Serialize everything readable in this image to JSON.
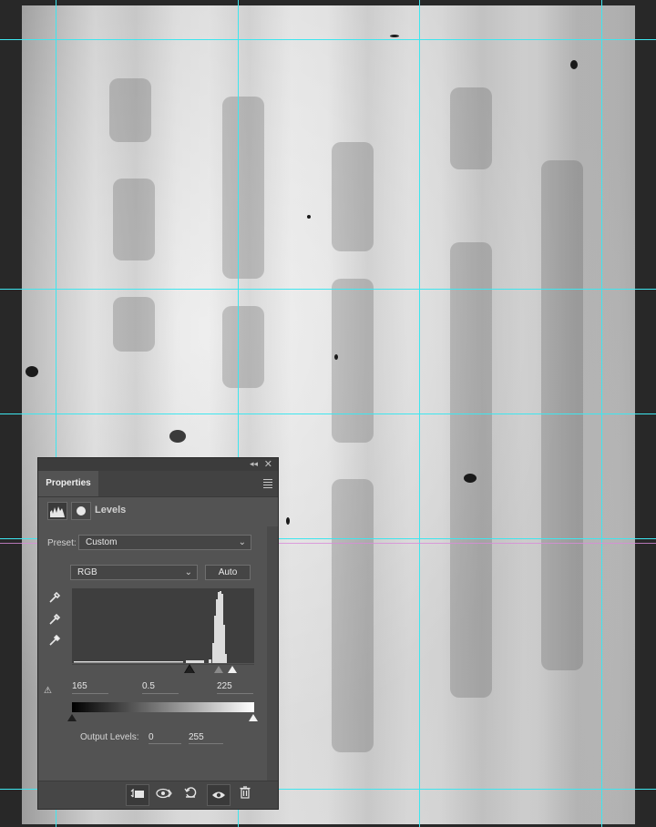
{
  "panel": {
    "tab_label": "Properties",
    "adjustment_title": "Levels",
    "preset_label": "Preset:",
    "preset_value": "Custom",
    "channel_value": "RGB",
    "auto_label": "Auto",
    "input_black": "165",
    "input_gamma": "0.5",
    "input_white": "225",
    "output_label": "Output Levels:",
    "output_black": "0",
    "output_white": "255"
  },
  "icons": {
    "collapse": "double-chevron-left-icon",
    "close": "close-icon",
    "menu": "hamburger-menu-icon",
    "eyedroppers": [
      "black-eyedropper-icon",
      "gray-eyedropper-icon",
      "white-eyedropper-icon"
    ],
    "bottom": [
      "clip-to-layer-icon",
      "view-previous-state-icon",
      "reset-icon",
      "visibility-eye-icon",
      "trash-icon"
    ]
  },
  "colors": {
    "guide": "#3ee6ef",
    "panel_bg": "#535353"
  }
}
